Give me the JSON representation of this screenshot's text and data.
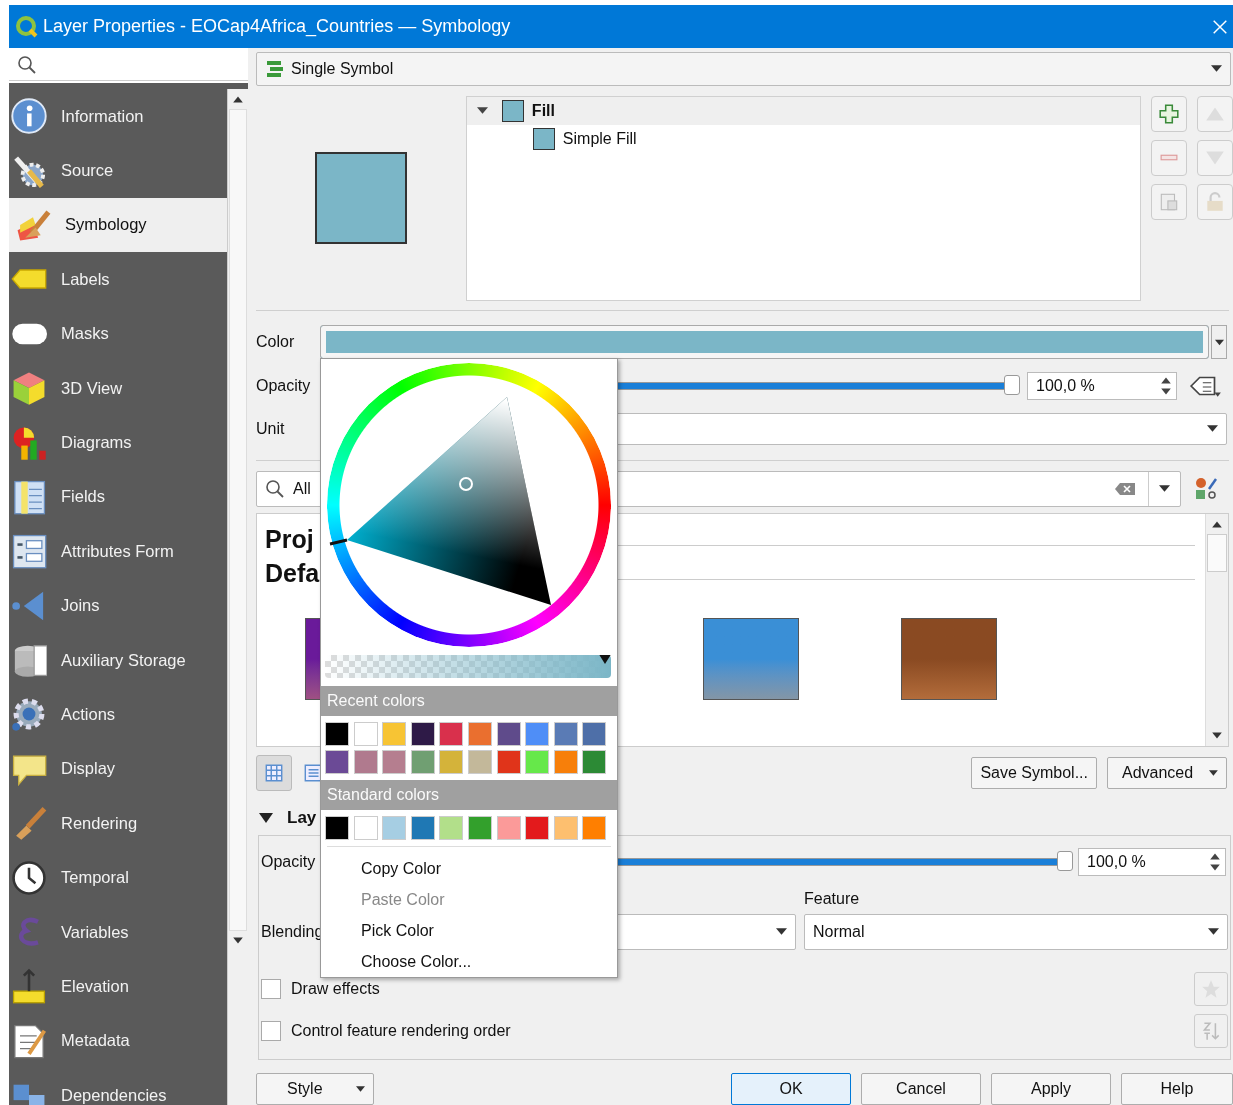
{
  "window": {
    "title": "Layer Properties - EOCap4Africa_Countries — Symbology"
  },
  "sidebar": {
    "items": [
      {
        "label": "Information",
        "selected": false
      },
      {
        "label": "Source",
        "selected": false
      },
      {
        "label": "Symbology",
        "selected": true
      },
      {
        "label": "Labels",
        "selected": false
      },
      {
        "label": "Masks",
        "selected": false
      },
      {
        "label": "3D View",
        "selected": false
      },
      {
        "label": "Diagrams",
        "selected": false
      },
      {
        "label": "Fields",
        "selected": false
      },
      {
        "label": "Attributes Form",
        "selected": false
      },
      {
        "label": "Joins",
        "selected": false
      },
      {
        "label": "Auxiliary Storage",
        "selected": false
      },
      {
        "label": "Actions",
        "selected": false
      },
      {
        "label": "Display",
        "selected": false
      },
      {
        "label": "Rendering",
        "selected": false
      },
      {
        "label": "Temporal",
        "selected": false
      },
      {
        "label": "Variables",
        "selected": false
      },
      {
        "label": "Elevation",
        "selected": false
      },
      {
        "label": "Metadata",
        "selected": false
      },
      {
        "label": "Dependencies",
        "selected": false
      }
    ]
  },
  "renderer": {
    "value": "Single Symbol"
  },
  "symbol_tree": [
    {
      "label": "Fill",
      "expanded": true,
      "children": [
        {
          "label": "Simple Fill"
        }
      ]
    }
  ],
  "color_row": {
    "label": "Color"
  },
  "opacity_row": {
    "label": "Opacity",
    "level": 1,
    "reading": "100,0 %"
  },
  "unit_row": {
    "label": "Unit"
  },
  "library": {
    "search_value": "All",
    "groups": [
      "Proj",
      "Defa"
    ],
    "symbols": [
      {
        "color": "#6a1a9a"
      },
      {
        "color": "#3a8fd6"
      },
      {
        "color": "#8a4a22"
      }
    ]
  },
  "save_symbol": "Save Symbol...",
  "advanced": "Advanced",
  "layer_rendering": {
    "title": "Lay",
    "expanded": true,
    "opacity_label": "Opacity",
    "level": 1,
    "reading": "100,0 %",
    "blending_label": "Blending",
    "feature_label": "Feature",
    "feature_value": "Normal",
    "checkboxes": [
      {
        "label": "Draw effects",
        "checked": false
      },
      {
        "label": "Control feature rendering order",
        "checked": false
      }
    ]
  },
  "footer": {
    "style": "Style",
    "buttons": [
      "OK",
      "Cancel",
      "Apply",
      "Help"
    ]
  },
  "color_popup": {
    "recent_title": "Recent colors",
    "recent": [
      {
        "color": "#000000"
      },
      {
        "color": "#ffffff"
      },
      {
        "color": "#f7c434"
      },
      {
        "color": "#2e1a47"
      },
      {
        "color": "#d9304c"
      },
      {
        "color": "#ea6f2f"
      },
      {
        "color": "#5f4b8b"
      },
      {
        "color": "#4f8ef7"
      },
      {
        "color": "#5a7bb5"
      },
      {
        "color": "#4e6fa8"
      },
      {
        "color": "#6b4a96"
      },
      {
        "color": "#b07a8e"
      },
      {
        "color": "#b57e8f"
      },
      {
        "color": "#709f72"
      },
      {
        "color": "#d4b33a"
      },
      {
        "color": "#c3b89a"
      },
      {
        "color": "#e0341a"
      },
      {
        "color": "#66e84a"
      },
      {
        "color": "#f77f0a"
      },
      {
        "color": "#2c8a35"
      }
    ],
    "standard_title": "Standard colors",
    "standard": [
      {
        "color": "#000000"
      },
      {
        "color": "#ffffff"
      },
      {
        "color": "#a6cee3"
      },
      {
        "color": "#1f78b4"
      },
      {
        "color": "#b2df8a"
      },
      {
        "color": "#33a02c"
      },
      {
        "color": "#fb9a99"
      },
      {
        "color": "#e31a1c"
      },
      {
        "color": "#fdbf6f"
      },
      {
        "color": "#ff7f00"
      }
    ],
    "menu": [
      {
        "label": "Copy Color",
        "disabled": false
      },
      {
        "label": "Paste Color",
        "disabled": true
      },
      {
        "label": "Pick Color",
        "disabled": false
      },
      {
        "label": "Choose Color...",
        "disabled": false
      }
    ]
  }
}
